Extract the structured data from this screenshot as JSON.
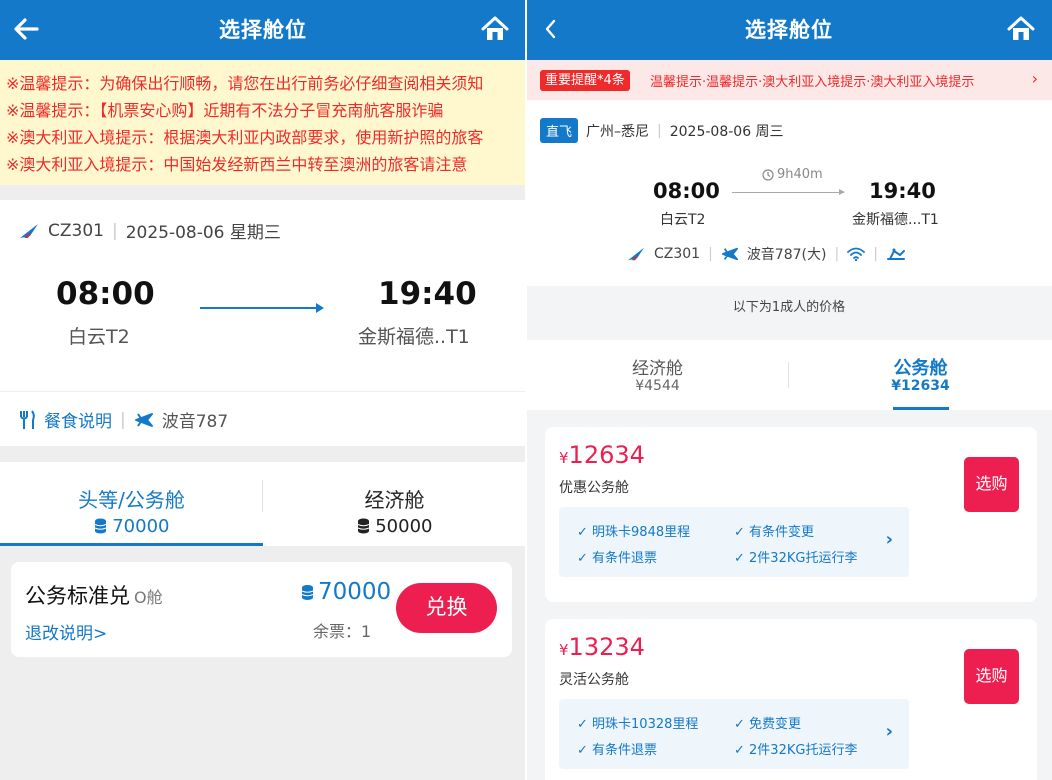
{
  "left": {
    "header": {
      "title": "选择舱位"
    },
    "notices": [
      "※温馨提示：为确保出行顺畅，请您在出行前务必仔细查阅相关须知",
      "※温馨提示：【机票安心购】近期有不法分子冒充南航客服诈骗",
      "※澳大利亚入境提示：根据澳大利亚内政部要求，使用新护照的旅客",
      "※澳大利亚入境提示：中国始发经新西兰中转至澳洲的旅客请注意"
    ],
    "flight": {
      "number": "CZ301",
      "date": "2025-08-06 星期三",
      "dep_time": "08:00",
      "dep_airport": "白云T2",
      "arr_time": "19:40",
      "arr_airport": "金斯福德..T1",
      "meal_label": "餐食说明",
      "aircraft": "波音787"
    },
    "tabs": [
      {
        "name": "头等/公务舱",
        "points": "70000",
        "active": true
      },
      {
        "name": "经济舱",
        "points": "50000",
        "active": false
      }
    ],
    "offer": {
      "name": "公务标准兑",
      "cabin": "O舱",
      "rules_link": "退改说明>",
      "points": "70000",
      "remaining": "余票：1",
      "button": "兑换"
    }
  },
  "right": {
    "header": {
      "title": "选择舱位"
    },
    "alert": {
      "badge": "重要提醒*4条",
      "text": "温馨提示·温馨提示·澳大利亚入境提示·澳大利亚入境提示"
    },
    "route": {
      "tag": "直飞",
      "cities": "广州–悉尼",
      "date": "2025-08-06 周三"
    },
    "flight": {
      "dep_time": "08:00",
      "dep_airport": "白云T2",
      "duration": "9h40m",
      "arr_time": "19:40",
      "arr_airport": "金斯福德...T1",
      "number": "CZ301",
      "aircraft": "波音787(大)"
    },
    "price_note": "以下为1成人的价格",
    "tabs": [
      {
        "name": "经济舱",
        "price": "¥4544",
        "active": false
      },
      {
        "name": "公务舱",
        "price": "¥12634",
        "active": true
      }
    ],
    "fares": [
      {
        "currency": "¥",
        "amount": "12634",
        "name": "优惠公务舱",
        "perks": [
          "明珠卡9848里程",
          "有条件变更",
          "有条件退票",
          "2件32KG托运行李"
        ],
        "button": "选购"
      },
      {
        "currency": "¥",
        "amount": "13234",
        "name": "灵活公务舱",
        "perks": [
          "明珠卡10328里程",
          "免费变更",
          "有条件退票",
          "2件32KG托运行李"
        ],
        "button": "选购"
      }
    ]
  },
  "colors": {
    "primary_blue": "#1479c8",
    "accent_red": "#ec1f50",
    "notice_bg": "#fff8cf",
    "notice_text": "#ef2a2a"
  }
}
